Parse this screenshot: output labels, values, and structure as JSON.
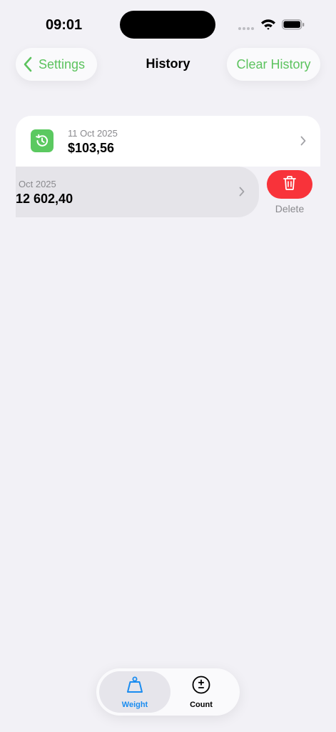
{
  "status_bar": {
    "time": "09:01"
  },
  "nav": {
    "back_label": "Settings",
    "title": "History",
    "clear_label": "Clear History"
  },
  "history": [
    {
      "date": "11 Oct 2025",
      "amount": "$103,56"
    },
    {
      "date": "Oct 2025",
      "amount": "12 602,40"
    }
  ],
  "swipe_action": {
    "label": "Delete"
  },
  "tabs": [
    {
      "label": "Weight",
      "icon": "weight-icon",
      "selected": true
    },
    {
      "label": "Count",
      "icon": "plus-minus-icon",
      "selected": false
    }
  ],
  "colors": {
    "accent_green": "#5CC35E",
    "delete_red": "#F8333A",
    "tab_active_blue": "#1A8CF0",
    "background": "#F2F1F6"
  }
}
